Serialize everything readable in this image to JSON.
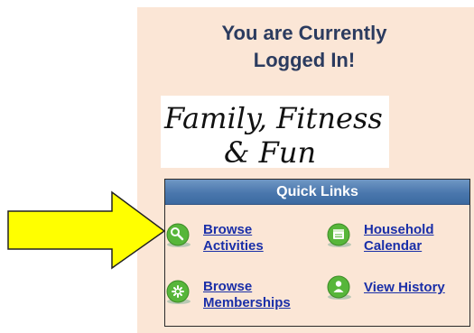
{
  "status": {
    "line1": "You are Currently",
    "line2": "Logged In!"
  },
  "tagline": {
    "line1": "Family, Fitness",
    "line2": "& Fun"
  },
  "quick_links": {
    "title": "Quick Links",
    "items": [
      {
        "label": "Browse\nActivities",
        "icon": "search-icon"
      },
      {
        "label": "Household\nCalendar",
        "icon": "calendar-icon"
      },
      {
        "label": "Browse\nMemberships",
        "icon": "membership-icon"
      },
      {
        "label": "View History",
        "icon": "user-icon"
      }
    ]
  },
  "colors": {
    "panel_bg": "#fbe6d6",
    "header_blue": "#4a77ad",
    "link_blue": "#1a2fa8",
    "title_navy": "#2b3b5f",
    "arrow_yellow": "#ffff00",
    "icon_green": "#57b63a"
  }
}
